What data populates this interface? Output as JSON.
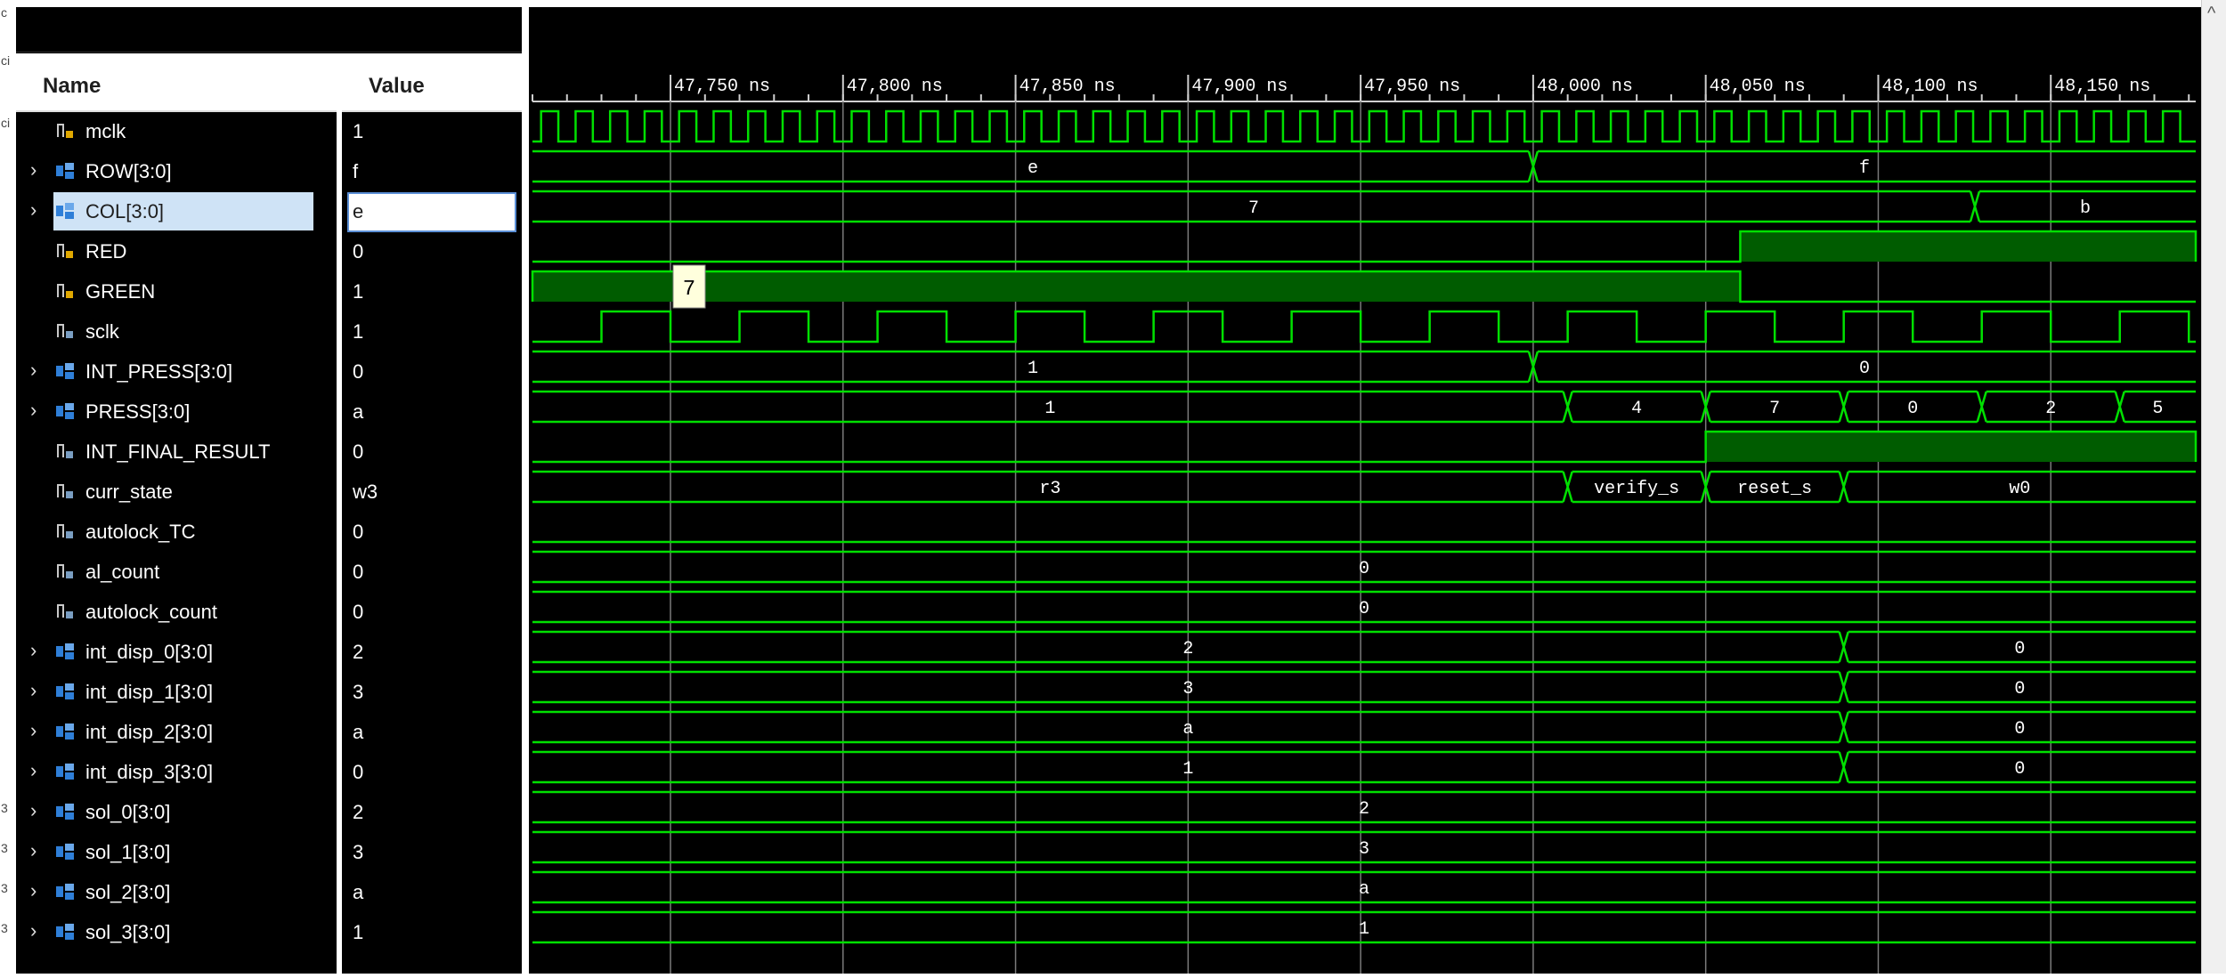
{
  "names_header": {
    "name": "Name",
    "value": "Value"
  },
  "left_edge_glyphs": [
    "c",
    "ci",
    "ci",
    "3",
    "3",
    "3",
    "3"
  ],
  "signals": [
    {
      "name": "mclk",
      "value": "1",
      "expandable": false,
      "icon": "signal-clock-icon"
    },
    {
      "name": "ROW[3:0]",
      "value": "f",
      "expandable": true,
      "icon": "bus-icon"
    },
    {
      "name": "COL[3:0]",
      "value": "e",
      "expandable": true,
      "icon": "bus-icon",
      "selected": true
    },
    {
      "name": "RED",
      "value": "0",
      "expandable": false,
      "icon": "signal-clock-icon"
    },
    {
      "name": "GREEN",
      "value": "1",
      "expandable": false,
      "icon": "signal-clock-icon"
    },
    {
      "name": "sclk",
      "value": "1",
      "expandable": false,
      "icon": "signal-icon"
    },
    {
      "name": "INT_PRESS[3:0]",
      "value": "0",
      "expandable": true,
      "icon": "bus-icon"
    },
    {
      "name": "PRESS[3:0]",
      "value": "a",
      "expandable": true,
      "icon": "bus-icon"
    },
    {
      "name": "INT_FINAL_RESULT",
      "value": "0",
      "expandable": false,
      "icon": "signal-icon"
    },
    {
      "name": "curr_state",
      "value": "w3",
      "expandable": false,
      "icon": "signal-icon"
    },
    {
      "name": "autolock_TC",
      "value": "0",
      "expandable": false,
      "icon": "signal-icon"
    },
    {
      "name": "al_count",
      "value": "0",
      "expandable": false,
      "icon": "signal-icon"
    },
    {
      "name": "autolock_count",
      "value": "0",
      "expandable": false,
      "icon": "signal-icon"
    },
    {
      "name": "int_disp_0[3:0]",
      "value": "2",
      "expandable": true,
      "icon": "bus-icon"
    },
    {
      "name": "int_disp_1[3:0]",
      "value": "3",
      "expandable": true,
      "icon": "bus-icon"
    },
    {
      "name": "int_disp_2[3:0]",
      "value": "a",
      "expandable": true,
      "icon": "bus-icon"
    },
    {
      "name": "int_disp_3[3:0]",
      "value": "0",
      "expandable": true,
      "icon": "bus-icon"
    },
    {
      "name": "sol_0[3:0]",
      "value": "2",
      "expandable": true,
      "icon": "bus-icon"
    },
    {
      "name": "sol_1[3:0]",
      "value": "3",
      "expandable": true,
      "icon": "bus-icon"
    },
    {
      "name": "sol_2[3:0]",
      "value": "a",
      "expandable": true,
      "icon": "bus-icon"
    },
    {
      "name": "sol_3[3:0]",
      "value": "1",
      "expandable": true,
      "icon": "bus-icon"
    }
  ],
  "timeline": {
    "unit": "ns",
    "labels": [
      "47,750 ns",
      "47,800 ns",
      "47,850 ns",
      "47,900 ns",
      "47,950 ns",
      "48,000 ns",
      "48,050 ns",
      "48,100 ns",
      "48,150 ns"
    ],
    "label_times": [
      47750,
      47800,
      47850,
      47900,
      47950,
      48000,
      48050,
      48100,
      48150
    ],
    "view_range_ns": [
      47710,
      48192
    ],
    "minor_ticks_per_major": 5
  },
  "tooltip": {
    "text": "7"
  },
  "colors": {
    "wave": "#00e000",
    "fill": "#005c00",
    "grid": "#7a7a7a",
    "wave_bg": "#000000",
    "selection": "#cfe3f6"
  },
  "waves": [
    {
      "signal": "mclk",
      "type": "clock",
      "period_ns": 10,
      "offset_ns": 2.5
    },
    {
      "signal": "ROW[3:0]",
      "type": "bus",
      "segments": [
        {
          "start": 47710,
          "end": 48000,
          "label": "e"
        },
        {
          "start": 48000,
          "end": 48192,
          "label": "f"
        }
      ]
    },
    {
      "signal": "COL[3:0]",
      "type": "bus",
      "segments": [
        {
          "start": 47710,
          "end": 48128,
          "label": "7"
        },
        {
          "start": 48128,
          "end": 48192,
          "label": "b"
        }
      ]
    },
    {
      "signal": "RED",
      "type": "bit",
      "high_intervals": [
        [
          48060,
          48192
        ]
      ],
      "filled": true
    },
    {
      "signal": "GREEN",
      "type": "bit",
      "high_intervals": [
        [
          47710,
          48060
        ]
      ],
      "filled": true
    },
    {
      "signal": "sclk",
      "type": "clock",
      "period_ns": 40,
      "offset_ns": 0,
      "high_first_ns": 47730
    },
    {
      "signal": "INT_PRESS[3:0]",
      "type": "bus",
      "segments": [
        {
          "start": 47710,
          "end": 48000,
          "label": "1"
        },
        {
          "start": 48000,
          "end": 48192,
          "label": "0"
        }
      ]
    },
    {
      "signal": "PRESS[3:0]",
      "type": "bus",
      "segments": [
        {
          "start": 47710,
          "end": 48010,
          "label": "1"
        },
        {
          "start": 48010,
          "end": 48050,
          "label": "4"
        },
        {
          "start": 48050,
          "end": 48090,
          "label": "7"
        },
        {
          "start": 48090,
          "end": 48130,
          "label": "0"
        },
        {
          "start": 48130,
          "end": 48170,
          "label": "2"
        },
        {
          "start": 48170,
          "end": 48192,
          "label": "5"
        }
      ]
    },
    {
      "signal": "INT_FINAL_RESULT",
      "type": "bit",
      "high_intervals": [
        [
          48050,
          48192
        ]
      ],
      "filled": true
    },
    {
      "signal": "curr_state",
      "type": "bus",
      "segments": [
        {
          "start": 47710,
          "end": 48010,
          "label": "r3"
        },
        {
          "start": 48010,
          "end": 48050,
          "label": "verify_s"
        },
        {
          "start": 48050,
          "end": 48090,
          "label": "reset_s"
        },
        {
          "start": 48090,
          "end": 48192,
          "label": "w0"
        }
      ]
    },
    {
      "signal": "autolock_TC",
      "type": "bit",
      "high_intervals": [],
      "filled": false
    },
    {
      "signal": "al_count",
      "type": "bus",
      "segments": [
        {
          "start": 47710,
          "end": 48192,
          "label": "0"
        }
      ]
    },
    {
      "signal": "autolock_count",
      "type": "bus",
      "segments": [
        {
          "start": 47710,
          "end": 48192,
          "label": "0"
        }
      ]
    },
    {
      "signal": "int_disp_0[3:0]",
      "type": "bus",
      "segments": [
        {
          "start": 47710,
          "end": 48090,
          "label": "2"
        },
        {
          "start": 48090,
          "end": 48192,
          "label": "0"
        }
      ]
    },
    {
      "signal": "int_disp_1[3:0]",
      "type": "bus",
      "segments": [
        {
          "start": 47710,
          "end": 48090,
          "label": "3"
        },
        {
          "start": 48090,
          "end": 48192,
          "label": "0"
        }
      ]
    },
    {
      "signal": "int_disp_2[3:0]",
      "type": "bus",
      "segments": [
        {
          "start": 47710,
          "end": 48090,
          "label": "a"
        },
        {
          "start": 48090,
          "end": 48192,
          "label": "0"
        }
      ]
    },
    {
      "signal": "int_disp_3[3:0]",
      "type": "bus",
      "segments": [
        {
          "start": 47710,
          "end": 48090,
          "label": "1"
        },
        {
          "start": 48090,
          "end": 48192,
          "label": "0"
        }
      ]
    },
    {
      "signal": "sol_0[3:0]",
      "type": "bus",
      "segments": [
        {
          "start": 47710,
          "end": 48192,
          "label": "2"
        }
      ]
    },
    {
      "signal": "sol_1[3:0]",
      "type": "bus",
      "segments": [
        {
          "start": 47710,
          "end": 48192,
          "label": "3"
        }
      ]
    },
    {
      "signal": "sol_2[3:0]",
      "type": "bus",
      "segments": [
        {
          "start": 47710,
          "end": 48192,
          "label": "a"
        }
      ]
    },
    {
      "signal": "sol_3[3:0]",
      "type": "bus",
      "segments": [
        {
          "start": 47710,
          "end": 48192,
          "label": "1"
        }
      ]
    }
  ]
}
